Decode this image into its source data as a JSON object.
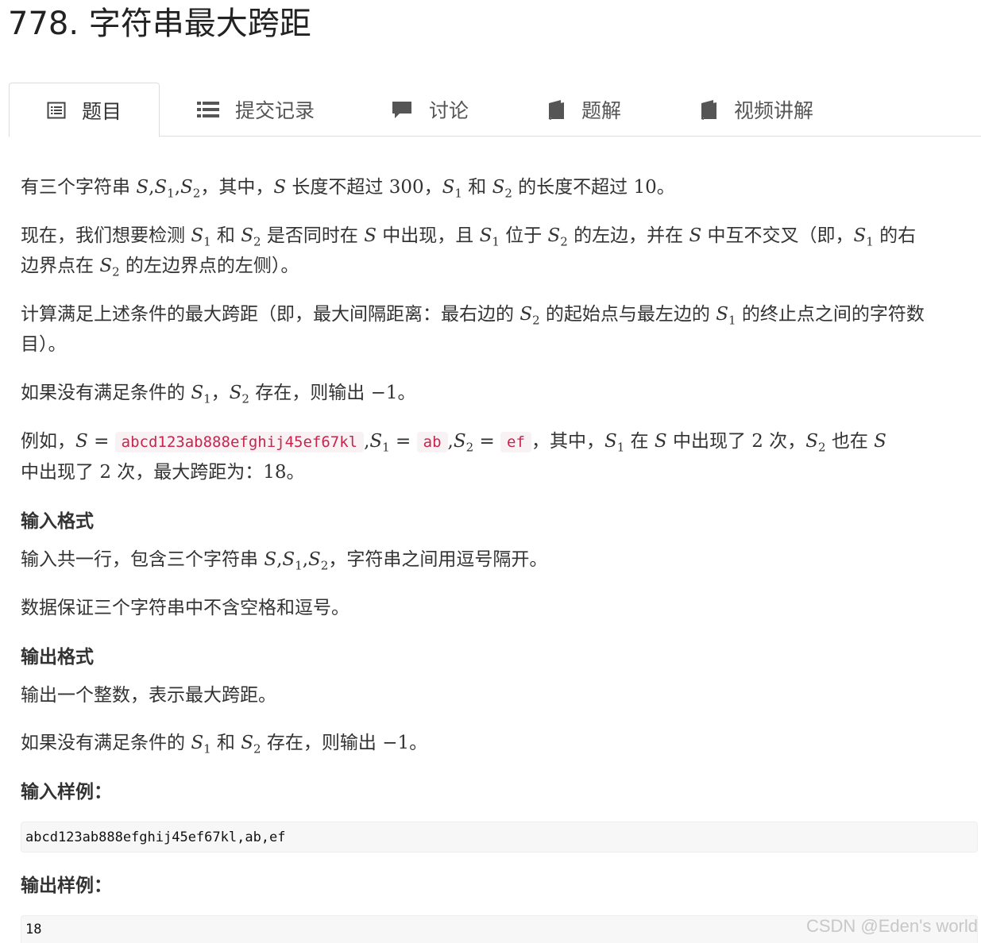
{
  "header": {
    "title": "778. 字符串最大跨距"
  },
  "tabs": [
    {
      "label": "题目",
      "icon": "list-alt-icon"
    },
    {
      "label": "提交记录",
      "icon": "list-icon"
    },
    {
      "label": "讨论",
      "icon": "comment-icon"
    },
    {
      "label": "题解",
      "icon": "book-icon"
    },
    {
      "label": "视频讲解",
      "icon": "book-icon"
    }
  ],
  "problem": {
    "p1": {
      "t1": "有三个字符串 ",
      "t2": "，其中，",
      "t3": " 长度不超过 ",
      "n300": "300",
      "t4": "，",
      "t5": " 和 ",
      "t6": " 的长度不超过 ",
      "n10": "10",
      "t7": "。"
    },
    "p2": {
      "t1": "现在，我们想要检测 ",
      "t2": " 和 ",
      "t3": " 是否同时在 ",
      "t4": " 中出现，且 ",
      "t5": " 位于 ",
      "t6": " 的左边，并在 ",
      "t7": " 中互不交叉（即，",
      "t8": " 的右",
      "t9": "边界点在 ",
      "t10": " 的左边界点的左侧）。"
    },
    "p3": {
      "l1a": "计算满足上述条件的最大跨距（即，最大间隔距离：最右边的 ",
      "l1b": " 的起始点与最左边的 ",
      "l1c": " 的终止点之间的字符数",
      "l2": "目）。"
    },
    "p4": {
      "t1": "如果没有满足条件的 ",
      "t2": "，",
      "t3": " 存在，则输出 ",
      "val": "−1",
      "t4": "。"
    },
    "p5": {
      "t1": "例如，",
      "eq": "=",
      "code_s": "abcd123ab888efghij45ef67kl",
      "code_s1": "ab",
      "code_s2": "ef",
      "t2": "，其中，",
      "t3": " 在 ",
      "t4": " 中出现了 ",
      "n2": "2",
      "t5": " 次，",
      "t6": " 也在 ",
      "l2a": "中出现了 ",
      "l2b": " 次，最大跨距为：",
      "n18": "18",
      "l2c": "。"
    },
    "input_format": {
      "title": "输入格式",
      "line1a": "输入共一行，包含三个字符串 ",
      "line1b": "，字符串之间用逗号隔开。",
      "line2": "数据保证三个字符串中不含空格和逗号。"
    },
    "output_format": {
      "title": "输出格式",
      "line1": "输出一个整数，表示最大跨距。",
      "line2a": "如果没有满足条件的 ",
      "line2b": " 和 ",
      "line2c": " 存在，则输出 ",
      "val": "−1",
      "line2d": "。"
    },
    "sample_input": {
      "title": "输入样例：",
      "value": "abcd123ab888efghij45ef67kl,ab,ef"
    },
    "sample_output": {
      "title": "输出样例：",
      "value": "18"
    }
  },
  "math": {
    "S": "S",
    "sub1": "1",
    "sub2": "2",
    "comma": ","
  },
  "watermark": "CSDN @Eden's world"
}
